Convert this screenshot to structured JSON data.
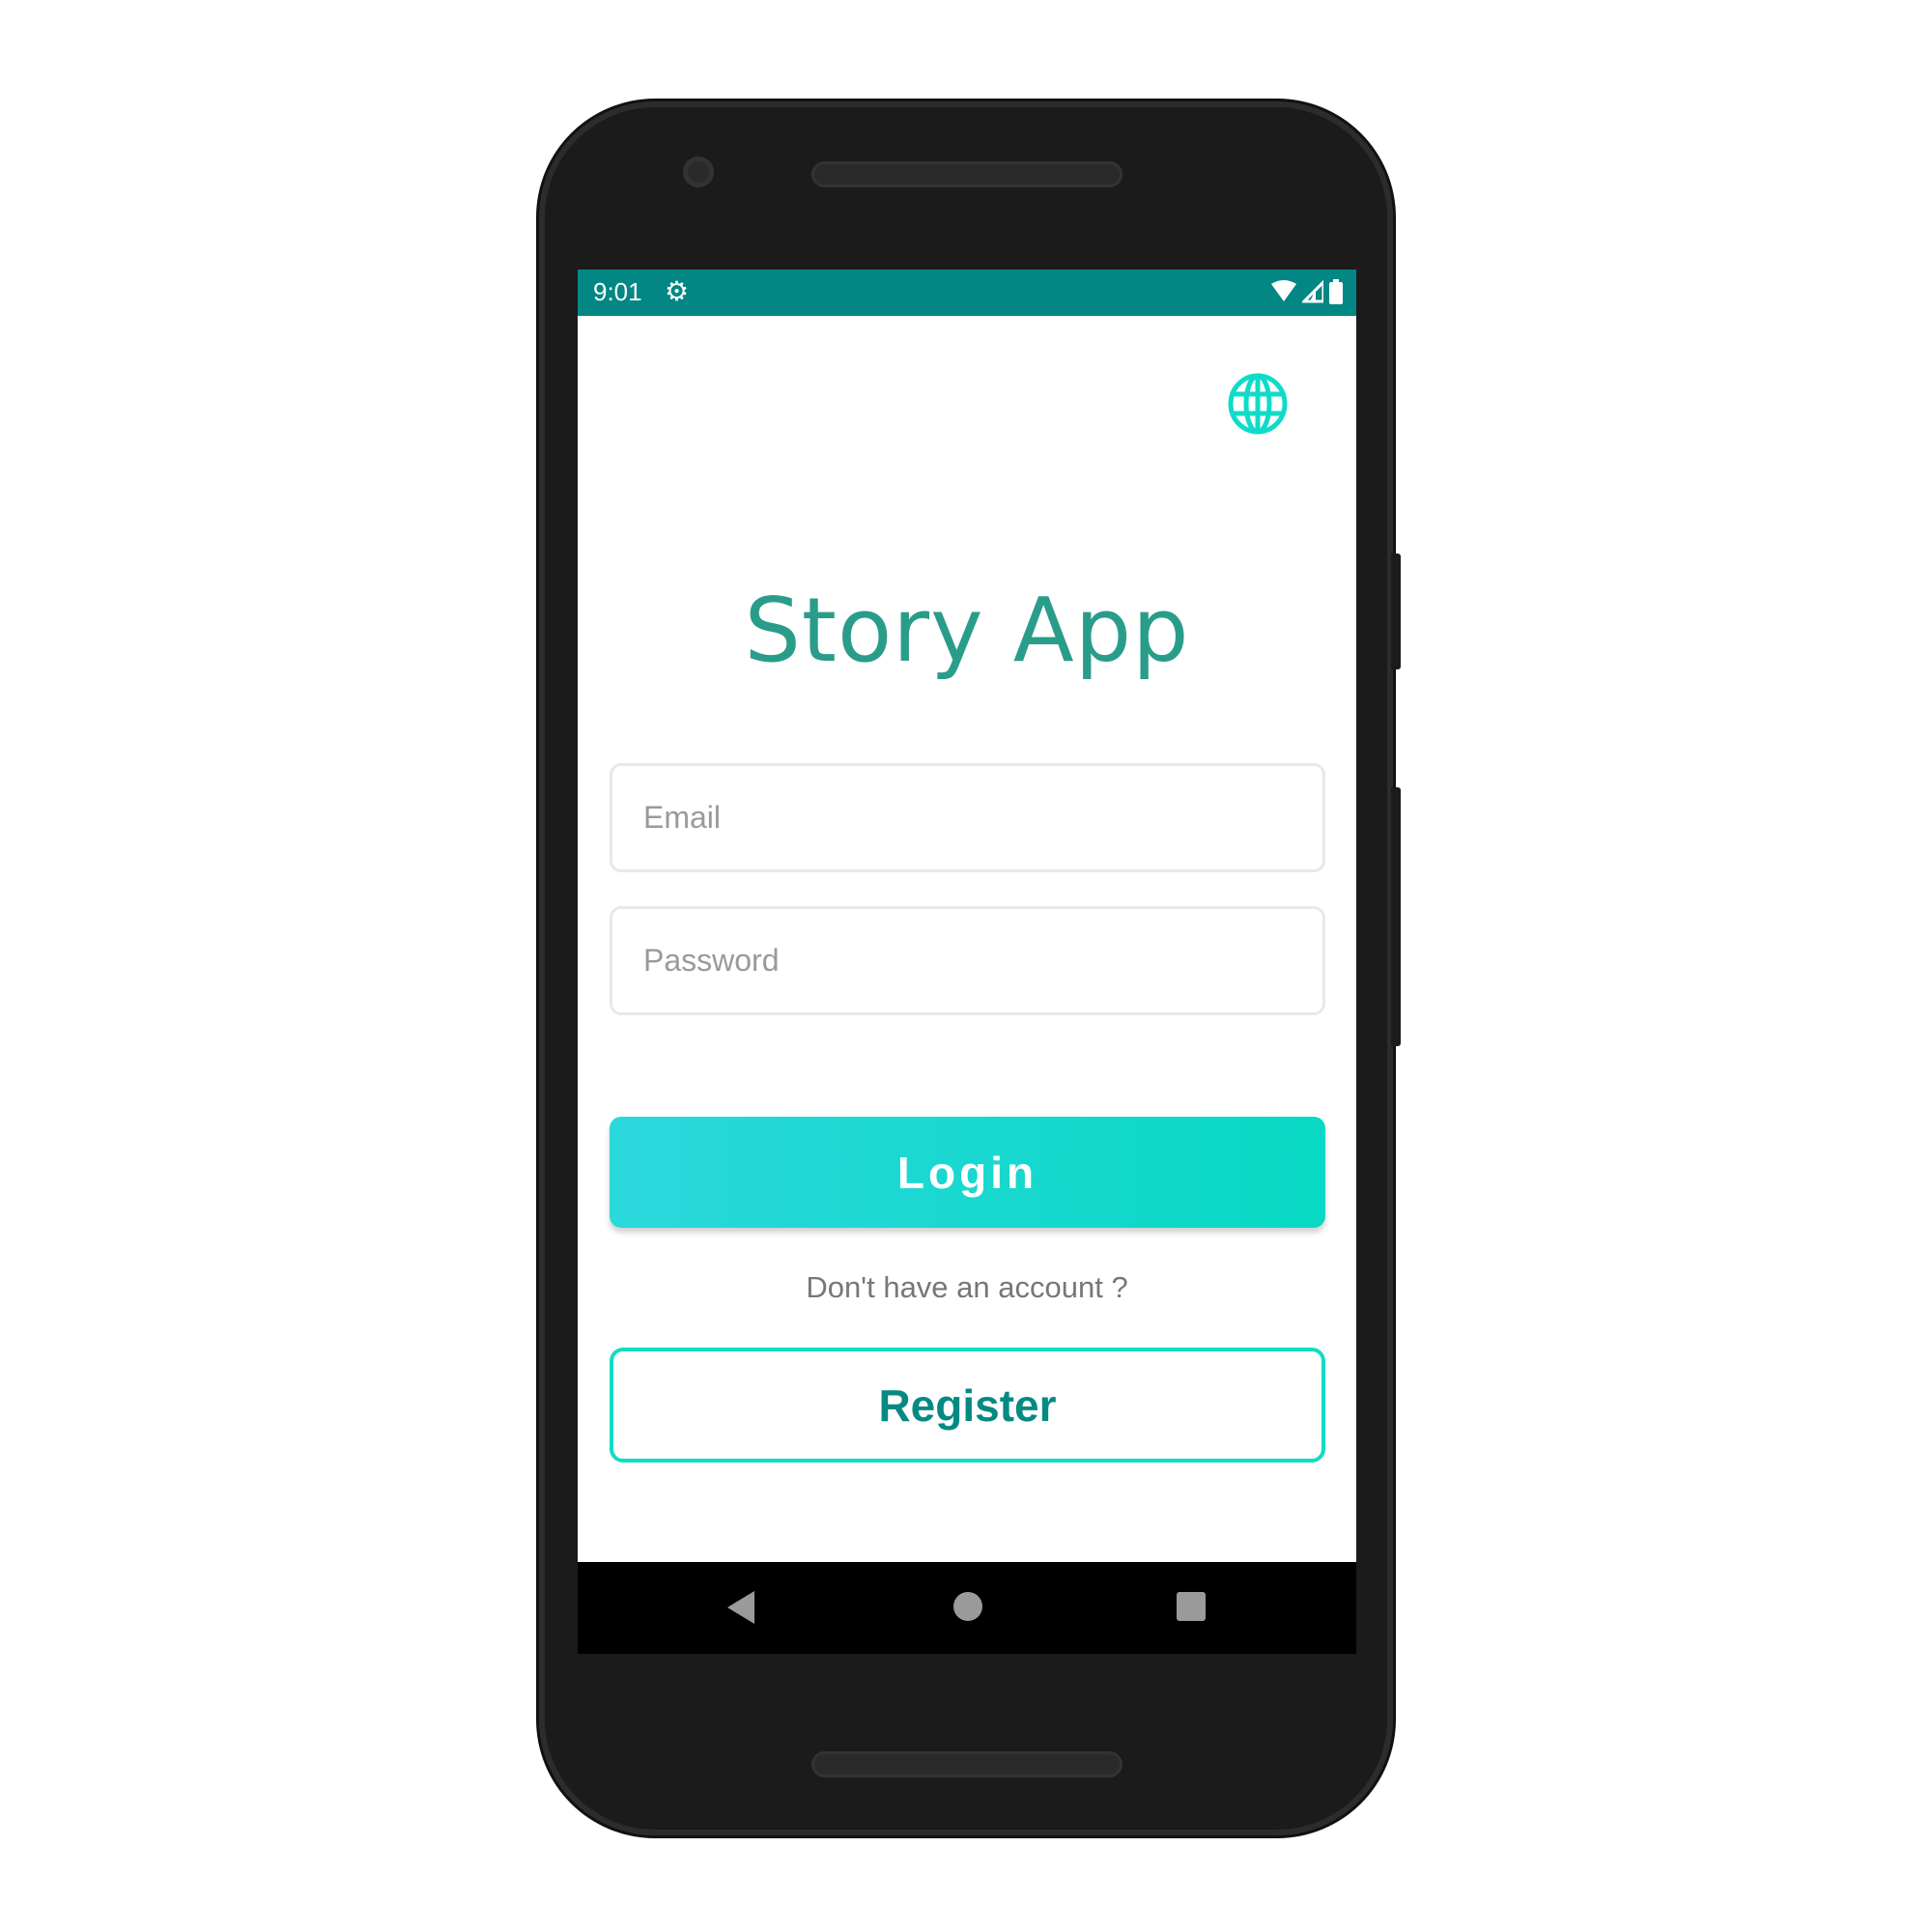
{
  "status_bar": {
    "time": "9:01",
    "icons": [
      "gear-icon",
      "wifi-icon",
      "signal-icon",
      "battery-icon"
    ]
  },
  "app": {
    "title": "Story App",
    "language_icon": "globe-icon"
  },
  "form": {
    "email_placeholder": "Email",
    "email_value": "",
    "password_placeholder": "Password",
    "password_value": ""
  },
  "actions": {
    "login_label": "Login",
    "no_account_text": "Don't have an account ?",
    "register_label": "Register"
  },
  "navigation": {
    "buttons": [
      "back",
      "home",
      "recents"
    ]
  },
  "colors": {
    "status_bar": "#028784",
    "accent": "#10dcc6",
    "title": "#2a9d8a",
    "register_text": "#058a83"
  }
}
